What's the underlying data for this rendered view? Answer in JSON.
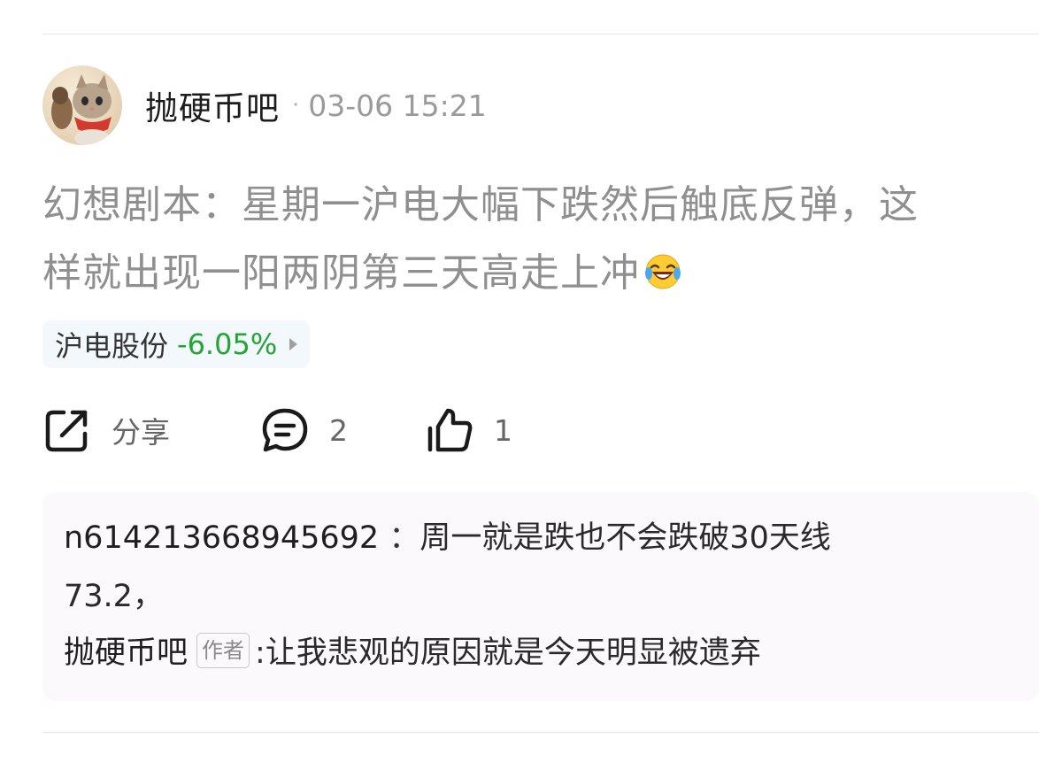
{
  "post": {
    "author": "抛硬币吧",
    "separator": "·",
    "time": "03-06 15:21",
    "text_line1": "幻想剧本：星期一沪电大幅下跌然后触底反弹，这",
    "text_line2": "样就出现一阳两阴第三天高走上冲",
    "emoji": "laughing-crying-emoji"
  },
  "stock_tag": {
    "name": "沪电股份",
    "change": "-6.05%",
    "change_color": "#23a535"
  },
  "actions": {
    "share_label": "分享",
    "comment_count": "2",
    "like_count": "1"
  },
  "comments": [
    {
      "user": "n614213668945692",
      "separator": "：",
      "text_line1": "周一就是跌也不会跌破30天线",
      "text_line2": "73.2，"
    },
    {
      "user": "抛硬币吧",
      "badge": "作者",
      "separator": ":",
      "text": "让我悲观的原因就是今天明显被遗弃"
    }
  ]
}
